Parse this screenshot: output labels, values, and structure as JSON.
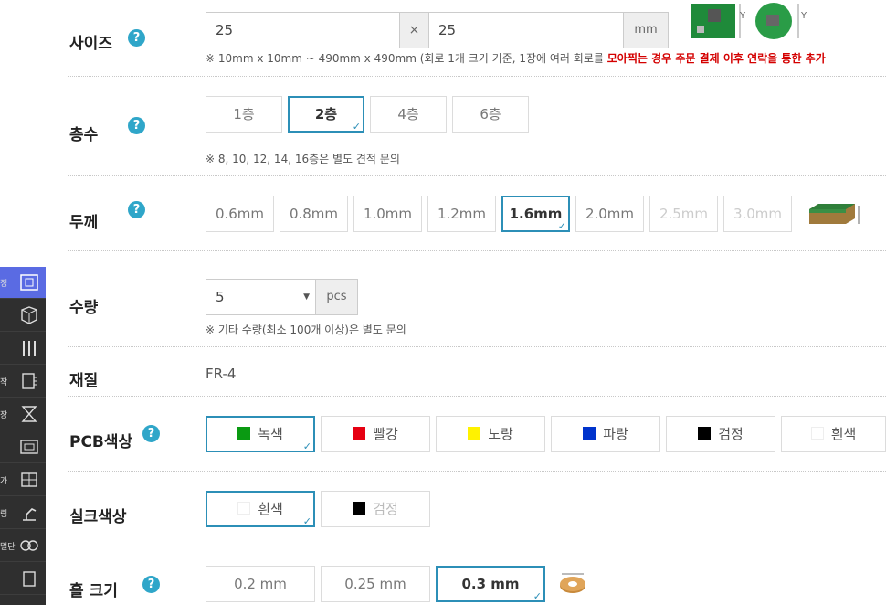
{
  "size": {
    "label": "사이즈",
    "width_value": "25",
    "separator": "×",
    "height_value": "25",
    "unit": "mm",
    "note_prefix": "※ 10mm x 10mm ~ 490mm x 490mm (회로 1개 크기 기준, 1장에 여러 회로를",
    "note_red": "모아찍는 경우 주문 결제 이후 연락을 통한 추가",
    "img_axis_y": "Y"
  },
  "layers": {
    "label": "층수",
    "options": [
      "1층",
      "2층",
      "4층",
      "6층"
    ],
    "selected": "2층",
    "note": "※ 8, 10, 12, 14, 16층은 별도 견적 문의"
  },
  "thickness": {
    "label": "두께",
    "options": [
      "0.6mm",
      "0.8mm",
      "1.0mm",
      "1.2mm",
      "1.6mm",
      "2.0mm",
      "2.5mm",
      "3.0mm"
    ],
    "selected": "1.6mm"
  },
  "quantity": {
    "label": "수량",
    "value": "5",
    "unit": "pcs",
    "note": "※ 기타 수량(최소 100개 이상)은 별도 문의"
  },
  "material": {
    "label": "재질",
    "value": "FR-4"
  },
  "pcb_color": {
    "label": "PCB색상",
    "options": [
      "녹색",
      "빨강",
      "노랑",
      "파랑",
      "검정",
      "흰색"
    ],
    "swatches": [
      "#0a9a12",
      "#e60012",
      "#fff200",
      "#0033cc",
      "#000000",
      "#ffffff"
    ],
    "selected": "녹색"
  },
  "silk_color": {
    "label": "실크색상",
    "options": [
      "흰색",
      "검정"
    ],
    "swatches": [
      "#ffffff",
      "#000000"
    ],
    "selected": "흰색"
  },
  "hole_size": {
    "label": "홀 크기",
    "options": [
      "0.2 mm",
      "0.25 mm",
      "0.3 mm"
    ],
    "selected": "0.3 mm"
  },
  "help_glyph": "?",
  "sidebar": {
    "labels": [
      "정",
      "작",
      "장",
      "가",
      "링",
      "판",
      "멀단"
    ]
  },
  "colors": {
    "accent": "#2c8fb7",
    "help": "#2fa6c9",
    "sidebar": "#2f2f2f",
    "sidebar_active": "#5a6be3"
  }
}
